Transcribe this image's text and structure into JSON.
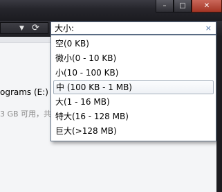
{
  "window": {
    "minimize_label": "–",
    "maximize_label": "□",
    "close_label": "✕"
  },
  "toolbar": {
    "chevron_icon": "chevron-down-icon",
    "refresh_icon": "refresh-icon"
  },
  "search": {
    "text": "大小:",
    "clear_label": "×"
  },
  "explorer": {
    "drive_label": "ograms (E:)",
    "drive_free": "3 GB 可用，共",
    "drive_used_fraction": 0.72
  },
  "size_filter": {
    "options": [
      "空(0 KB)",
      "微小(0 - 10 KB)",
      "小(10 - 100 KB)",
      "中 (100 KB - 1 MB)",
      "大(1 - 16 MB)",
      "特大(16 - 128 MB)",
      "巨大(>128 MB)"
    ],
    "selected_index": 3
  }
}
